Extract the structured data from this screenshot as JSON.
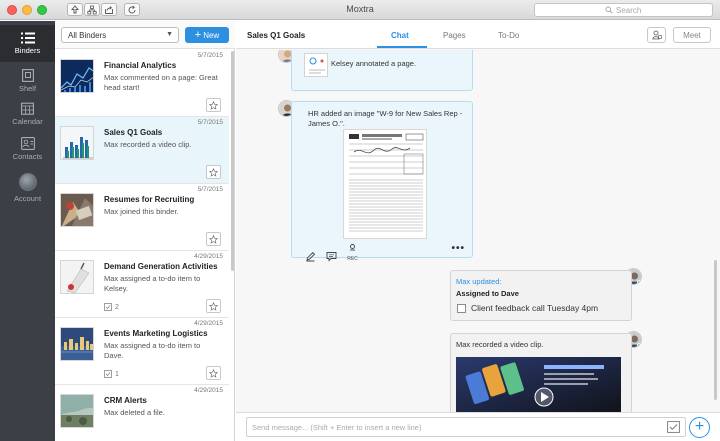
{
  "window": {
    "title": "Moxtra",
    "search_placeholder": "Search"
  },
  "nav": [
    {
      "label": "Binders",
      "icon": "list-icon",
      "active": true
    },
    {
      "label": "Shelf",
      "icon": "shelf-icon"
    },
    {
      "label": "Calendar",
      "icon": "calendar-icon"
    },
    {
      "label": "Contacts",
      "icon": "contacts-icon"
    },
    {
      "label": "Account",
      "icon": "avatar"
    }
  ],
  "list": {
    "filter": "All Binders",
    "new_label": "New",
    "binders": [
      {
        "title": "Financial Analytics",
        "date": "5/7/2015",
        "sub": "Max commented on a page: Great head start!"
      },
      {
        "title": "Sales Q1 Goals",
        "date": "5/7/2015",
        "sub": "Max recorded a video clip."
      },
      {
        "title": "Resumes for Recruiting",
        "date": "5/7/2015",
        "sub": "Max joined this binder."
      },
      {
        "title": "Demand Generation Activities",
        "date": "4/29/2015",
        "sub": "Max assigned a to-do item to Kelsey.",
        "todos": "2"
      },
      {
        "title": "Events Marketing Logistics",
        "date": "4/29/2015",
        "sub": "Max assigned a to-do item to Dave.",
        "todos": "1"
      },
      {
        "title": "CRM Alerts",
        "date": "4/29/2015",
        "sub": "Max deleted a file."
      }
    ]
  },
  "main": {
    "title": "Sales Q1 Goals",
    "tabs": [
      "Chat",
      "Pages",
      "To-Do"
    ],
    "meet_label": "Meet",
    "messages": {
      "kelsey": "Kelsey annotated a page.",
      "hr": "HR added an image \"W-9 for New Sales Rep - James O.\".",
      "rec_label": "REC",
      "max_updated": "Max updated:",
      "assigned": "Assigned to Dave",
      "todo_text": "Client feedback call Tuesday 4pm",
      "video_caption": "Max recorded a video clip."
    },
    "composer_placeholder": "Send message... (Shift + Enter to insert a new line)"
  },
  "colors": {
    "accent": "#2d8fe0",
    "nav_bg": "#3c3f45",
    "selected_row": "#e8f5fb"
  }
}
